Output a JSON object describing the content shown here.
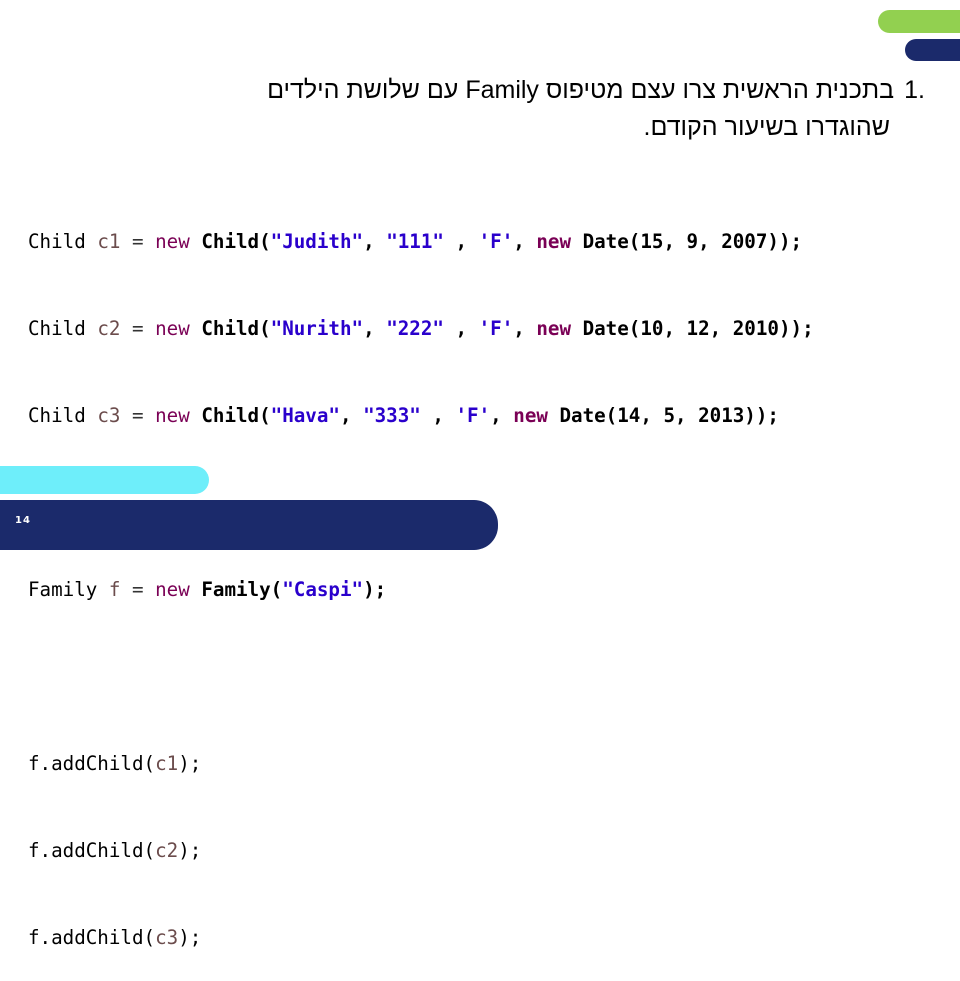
{
  "slide": {
    "number": "14",
    "colors": {
      "green_bar": "#92d050",
      "navy": "#1b2a6b",
      "cyan_bar": "#6eeefa"
    }
  },
  "heading": {
    "number": ".1",
    "line1": "בתכנית הראשית צרו עצם מטיפוס Family עם שלושת הילדים",
    "line2": "שהוגדרו בשיעור הקודם."
  },
  "code": {
    "children": [
      {
        "type": "Child",
        "var": "c1",
        "kw": "new",
        "ctor": "Child(",
        "name": "\"Judith\"",
        "sep1": ", ",
        "id": "\"111\"",
        "sep2": " , ",
        "gender": "'F'",
        "sep3": ", ",
        "kw2": "new",
        "date": " Date(15, 9, 2007));"
      },
      {
        "type": "Child",
        "var": "c2",
        "kw": "new",
        "ctor": "Child(",
        "name": "\"Nurith\"",
        "sep1": ", ",
        "id": "\"222\"",
        "sep2": " , ",
        "gender": "'F'",
        "sep3": ", ",
        "kw2": "new",
        "date": " Date(10, 12, 2010));"
      },
      {
        "type": "Child",
        "var": "c3",
        "kw": "new",
        "ctor": "Child(",
        "name": "\"Hava\"",
        "sep1": ", ",
        "id": "\"333\"",
        "sep2": " , ",
        "gender": "'F'",
        "sep3": ", ",
        "kw2": "new",
        "date": " Date(14, 5, 2013));"
      }
    ],
    "family": {
      "type": "Family",
      "var": "f",
      "kw": "new",
      "ctor": "Family(",
      "name": "\"Caspi\"",
      "end": ");"
    },
    "add_calls": [
      {
        "prefix": "f.addChild(",
        "arg": "c1",
        "end": ");"
      },
      {
        "prefix": "f.addChild(",
        "arg": "c2",
        "end": ");"
      },
      {
        "prefix": "f.addChild(",
        "arg": "c3",
        "end": ");"
      }
    ]
  }
}
